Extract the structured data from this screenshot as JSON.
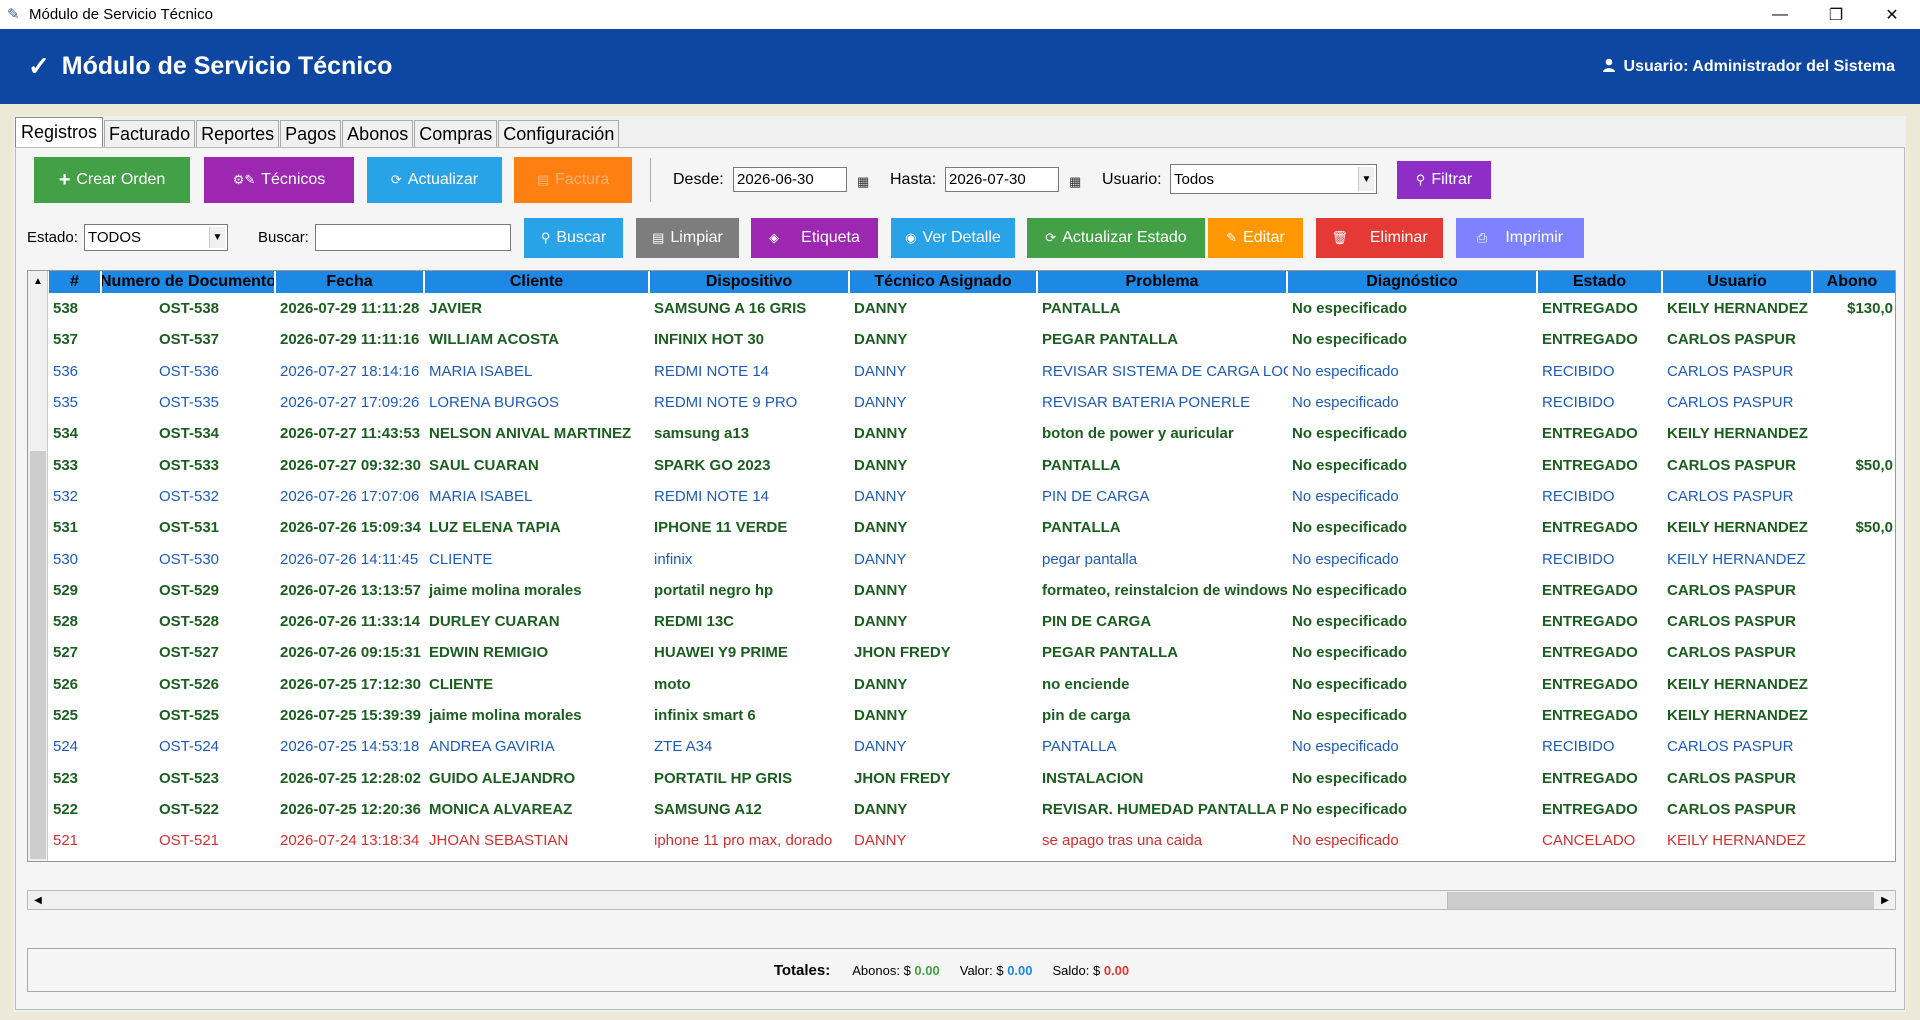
{
  "window": {
    "title": "Módulo de Servicio Técnico",
    "minimize": "—",
    "restore": "❐",
    "close": "✕"
  },
  "header": {
    "check": "✓",
    "title": "Módulo de Servicio Técnico",
    "user": "Usuario: Administrador del Sistema"
  },
  "tabs": [
    "Registros",
    "Facturado",
    "Reportes",
    "Pagos",
    "Abonos",
    "Compras",
    "Configuración"
  ],
  "toolbar1": {
    "crear_orden": "Crear Orden",
    "tecnicos": "Técnicos",
    "actualizar": "Actualizar",
    "factura": "Factura",
    "desde_label": "Desde:",
    "desde_value": "2026-06-30",
    "hasta_label": "Hasta:",
    "hasta_value": "2026-07-30",
    "usuario_label": "Usuario:",
    "usuario_value": "Todos",
    "filtrar": "Filtrar"
  },
  "toolbar2": {
    "estado_label": "Estado:",
    "estado_value": "TODOS",
    "buscar_label": "Buscar:",
    "buscar_value": "",
    "buscar": "Buscar",
    "limpiar": "Limpiar",
    "etiqueta": "Etiqueta",
    "ver_detalle": "Ver Detalle",
    "actualizar_estado": "Actualizar Estado",
    "editar": "Editar",
    "eliminar": "Eliminar",
    "imprimir": "Imprimir"
  },
  "colors": {
    "crear": "#43a047",
    "tecnicos": "#9c27b0",
    "actualizar": "#29a3e8",
    "factura": "#ff7f11",
    "filtrar": "#8e2ec7",
    "buscar": "#29a3e8",
    "limpiar": "#7d7d7d",
    "etiqueta": "#9c27b0",
    "ver_detalle": "#29a3e8",
    "actualizar_estado": "#43a047",
    "editar": "#ff9800",
    "eliminar": "#e53935",
    "imprimir": "#7c83fd"
  },
  "table": {
    "columns": [
      "#",
      "Numero de Documento",
      "Fecha",
      "Cliente",
      "Dispositivo",
      "Técnico Asignado",
      "Problema",
      "Diagnóstico",
      "Estado",
      "Usuario",
      "Abono"
    ],
    "rows": [
      [
        "538",
        "OST-538",
        "2026-07-29 11:11:28",
        "JAVIER",
        "SAMSUNG A 16 GRIS",
        "DANNY",
        "PANTALLA",
        "No especificado",
        "ENTREGADO",
        "KEILY HERNANDEZ",
        "$130,0"
      ],
      [
        "537",
        "OST-537",
        "2026-07-29 11:11:16",
        "WILLIAM ACOSTA",
        "INFINIX HOT 30",
        "DANNY",
        "PEGAR PANTALLA",
        "No especificado",
        "ENTREGADO",
        "CARLOS PASPUR",
        ""
      ],
      [
        "536",
        "OST-536",
        "2026-07-27 18:14:16",
        "MARIA ISABEL",
        "REDMI NOTE 14",
        "DANNY",
        "REVISAR SISTEMA DE CARGA LOGICA",
        "No especificado",
        "RECIBIDO",
        "CARLOS PASPUR",
        ""
      ],
      [
        "535",
        "OST-535",
        "2026-07-27 17:09:26",
        "LORENA BURGOS",
        "REDMI NOTE 9 PRO",
        "DANNY",
        "REVISAR BATERIA PONERLE",
        "No especificado",
        "RECIBIDO",
        "CARLOS PASPUR",
        ""
      ],
      [
        "534",
        "OST-534",
        "2026-07-27 11:43:53",
        "NELSON ANIVAL MARTINEZ",
        "samsung a13",
        "DANNY",
        "boton de power y auricular",
        "No especificado",
        "ENTREGADO",
        "KEILY HERNANDEZ",
        ""
      ],
      [
        "533",
        "OST-533",
        "2026-07-27 09:32:30",
        "SAUL CUARAN",
        "SPARK GO 2023",
        "DANNY",
        "PANTALLA",
        "No especificado",
        "ENTREGADO",
        "CARLOS PASPUR",
        "$50,0"
      ],
      [
        "532",
        "OST-532",
        "2026-07-26 17:07:06",
        "MARIA ISABEL",
        "REDMI NOTE 14",
        "DANNY",
        "PIN DE CARGA",
        "No especificado",
        "RECIBIDO",
        "CARLOS PASPUR",
        ""
      ],
      [
        "531",
        "OST-531",
        "2026-07-26 15:09:34",
        "LUZ ELENA TAPIA",
        "IPHONE 11 VERDE",
        "DANNY",
        "PANTALLA",
        "No especificado",
        "ENTREGADO",
        "KEILY HERNANDEZ",
        "$50,0"
      ],
      [
        "530",
        "OST-530",
        "2026-07-26 14:11:45",
        "CLIENTE",
        "infinix",
        "DANNY",
        "pegar pantalla",
        "No especificado",
        "RECIBIDO",
        "KEILY HERNANDEZ",
        ""
      ],
      [
        "529",
        "OST-529",
        "2026-07-26 13:13:57",
        "jaime molina morales",
        "portatil negro hp",
        "DANNY",
        "formateo, reinstalcion de windows",
        "No especificado",
        "ENTREGADO",
        "CARLOS PASPUR",
        ""
      ],
      [
        "528",
        "OST-528",
        "2026-07-26 11:33:14",
        "DURLEY CUARAN",
        "REDMI 13C",
        "DANNY",
        "PIN DE CARGA",
        "No especificado",
        "ENTREGADO",
        "CARLOS PASPUR",
        ""
      ],
      [
        "527",
        "OST-527",
        "2026-07-26 09:15:31",
        "EDWIN REMIGIO",
        "HUAWEI Y9 PRIME",
        "JHON FREDY",
        "PEGAR PANTALLA",
        "No especificado",
        "ENTREGADO",
        "CARLOS PASPUR",
        ""
      ],
      [
        "526",
        "OST-526",
        "2026-07-25 17:12:30",
        "CLIENTE",
        "moto",
        "DANNY",
        "no enciende",
        "No especificado",
        "ENTREGADO",
        "KEILY HERNANDEZ",
        ""
      ],
      [
        "525",
        "OST-525",
        "2026-07-25 15:39:39",
        "jaime molina morales",
        "infinix smart 6",
        "DANNY",
        "pin de carga",
        "No especificado",
        "ENTREGADO",
        "KEILY HERNANDEZ",
        ""
      ],
      [
        "524",
        "OST-524",
        "2026-07-25 14:53:18",
        "ANDREA GAVIRIA",
        "ZTE A34",
        "DANNY",
        "PANTALLA",
        "No especificado",
        "RECIBIDO",
        "CARLOS PASPUR",
        ""
      ],
      [
        "523",
        "OST-523",
        "2026-07-25 12:28:02",
        "GUIDO ALEJANDRO",
        "PORTATIL HP GRIS",
        "JHON FREDY",
        "INSTALACION",
        "No especificado",
        "ENTREGADO",
        "CARLOS PASPUR",
        ""
      ],
      [
        "522",
        "OST-522",
        "2026-07-25 12:20:36",
        "MONICA ALVAREAZ",
        "SAMSUNG A12",
        "DANNY",
        "REVISAR. HUMEDAD PANTALLA PA",
        "No especificado",
        "ENTREGADO",
        "CARLOS PASPUR",
        ""
      ],
      [
        "521",
        "OST-521",
        "2026-07-24 13:18:34",
        "JHOAN SEBASTIAN",
        "iphone 11 pro max, dorado",
        "DANNY",
        "se apago tras una caida",
        "No especificado",
        "CANCELADO",
        "KEILY HERNANDEZ",
        ""
      ]
    ]
  },
  "totals": {
    "title": "Totales:",
    "abonos_label": "Abonos: $",
    "abonos_value": "0.00",
    "valor_label": "Valor: $",
    "valor_value": "0.00",
    "saldo_label": "Saldo: $",
    "saldo_value": "0.00"
  }
}
